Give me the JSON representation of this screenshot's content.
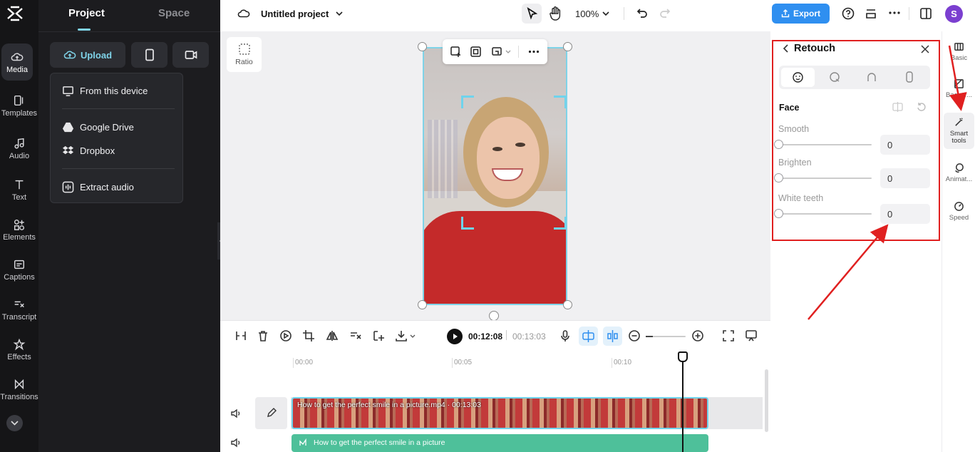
{
  "rail": {
    "items": [
      {
        "label": "Media",
        "icon": "cloud-icon"
      },
      {
        "label": "Templates",
        "icon": "templates-icon"
      },
      {
        "label": "Audio",
        "icon": "music-icon"
      },
      {
        "label": "Text",
        "icon": "text-icon"
      },
      {
        "label": "Elements",
        "icon": "elements-icon"
      },
      {
        "label": "Captions",
        "icon": "captions-icon"
      },
      {
        "label": "Transcript",
        "icon": "transcript-icon"
      },
      {
        "label": "Effects",
        "icon": "effects-icon"
      },
      {
        "label": "Transitions",
        "icon": "transitions-icon"
      }
    ]
  },
  "panel": {
    "tab_project": "Project",
    "tab_space": "Space",
    "upload_label": "Upload",
    "dropdown": {
      "from_device": "From this device",
      "google_drive": "Google Drive",
      "dropbox": "Dropbox",
      "extract_audio": "Extract audio"
    }
  },
  "topbar": {
    "project_title": "Untitled project",
    "zoom": "100%",
    "export_label": "Export",
    "avatar_letter": "S"
  },
  "canvas": {
    "ratio_label": "Ratio"
  },
  "playback": {
    "current_time": "00:12:08",
    "total_time": "00:13:03"
  },
  "timeline": {
    "ruler": [
      "00:00",
      "00:05",
      "00:10"
    ],
    "video_clip_label": "How to get the perfect smile in a picture.mp4 · 00:13:03",
    "audio_clip_label": "How to get the perfect smile in a picture"
  },
  "retouch": {
    "title": "Retouch",
    "section": "Face",
    "sliders": [
      {
        "label": "Smooth",
        "value": "0"
      },
      {
        "label": "Brighten",
        "value": "0"
      },
      {
        "label": "White teeth",
        "value": "0"
      }
    ]
  },
  "siderail": {
    "items": [
      {
        "label": "Basic"
      },
      {
        "label": "Backgr..."
      },
      {
        "label": "Smart tools"
      },
      {
        "label": "Animat..."
      },
      {
        "label": "Speed"
      }
    ]
  },
  "colors": {
    "accent": "#2f8ff0",
    "highlight": "#e02020",
    "clip_video": "#c23a3a",
    "clip_audio": "#4ec09a"
  }
}
